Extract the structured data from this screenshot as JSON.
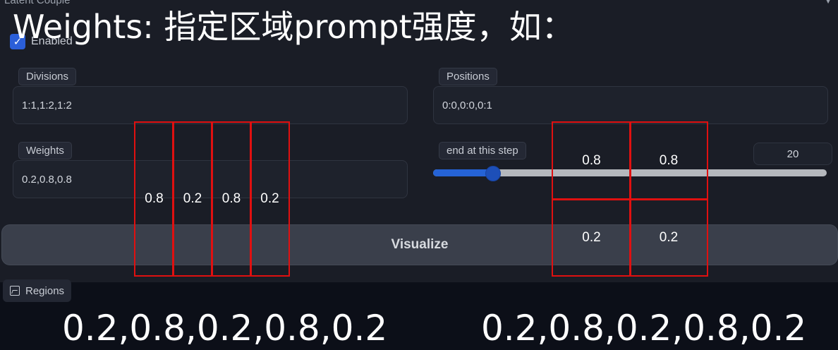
{
  "panel": {
    "title": "Latent Couple",
    "collapse_icon": "triangle-down-icon"
  },
  "caption": "Weights: 指定区域prompt强度，如：",
  "enabled": {
    "label": "Enabled",
    "checked": true
  },
  "divisions": {
    "label": "Divisions",
    "value": "1:1,1:2,1:2"
  },
  "positions": {
    "label": "Positions",
    "value": "0:0,0:0,0:1"
  },
  "weights": {
    "label": "Weights",
    "value": "0.2,0.8,0.8"
  },
  "end_step": {
    "label": "end at this step",
    "value": "20",
    "slider_fraction": 0.15
  },
  "visualize_label": "Visualize",
  "regions_tab": {
    "label": "Regions",
    "icon": "image-icon"
  },
  "overlay_left": {
    "cells": [
      "0.8",
      "0.2",
      "0.8",
      "0.2"
    ]
  },
  "overlay_right": {
    "cells": [
      "0.8",
      "0.8",
      "0.2",
      "0.2"
    ]
  },
  "bottom_left": "0.2,0.8,0.2,0.8,0.2",
  "bottom_right": "0.2,0.8,0.2,0.8,0.2",
  "colors": {
    "accent": "#2563d6",
    "overlay_red": "#e01010",
    "panel_bg": "#1a1d26"
  }
}
